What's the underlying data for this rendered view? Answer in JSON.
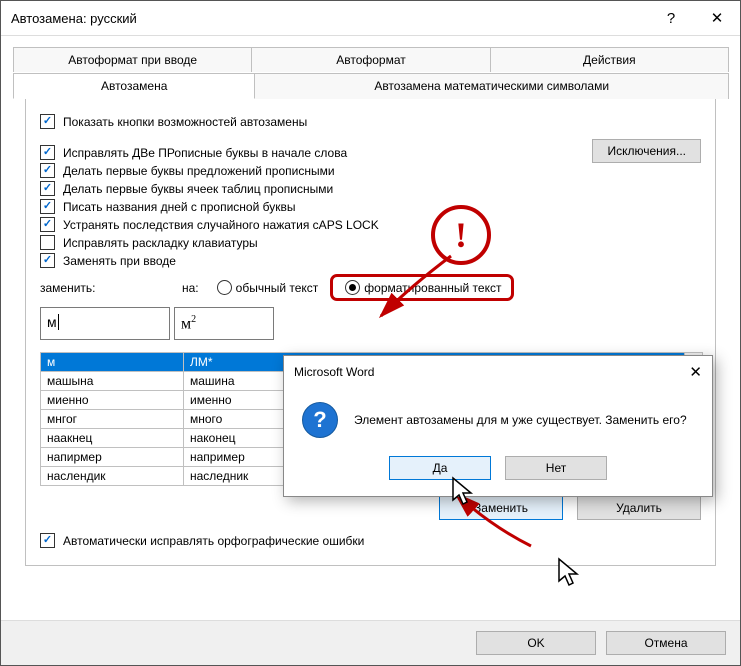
{
  "title": "Автозамена: русский",
  "help_symbol": "?",
  "close_symbol": "✕",
  "tabs_top": [
    "Автоформат при вводе",
    "Автоформат",
    "Действия"
  ],
  "tabs_bottom": [
    "Автозамена",
    "Автозамена математическими символами"
  ],
  "active_tab": "Автозамена",
  "chk_show_buttons": "Показать кнопки возможностей автозамены",
  "chk_two_caps": "Исправлять ДВе ПРописные буквы в начале слова",
  "chk_first_sentence": "Делать первые буквы предложений прописными",
  "chk_first_cells": "Делать первые буквы ячеек таблиц прописными",
  "chk_days": "Писать названия дней с прописной буквы",
  "chk_capslock": "Устранять последствия случайного нажатия cAPS LOCK",
  "chk_keyboard": "Исправлять раскладку клавиатуры",
  "chk_replace_typing": "Заменять при вводе",
  "exceptions_btn": "Исключения...",
  "label_replace": "заменить:",
  "label_with": "на:",
  "radio_plain": "обычный текст",
  "radio_formatted": "форматированный текст",
  "input_left_value": "м",
  "input_right_value": "м",
  "input_right_sup": "2",
  "table": {
    "header": [
      "м",
      "ЛМ*"
    ],
    "rows": [
      [
        "машына",
        "машина"
      ],
      [
        "миенно",
        "именно"
      ],
      [
        "мнгог",
        "много"
      ],
      [
        "наакнец",
        "наконец"
      ],
      [
        "напирмер",
        "например"
      ],
      [
        "наслендик",
        "наследник"
      ]
    ]
  },
  "btn_replace": "Заменить",
  "btn_delete": "Удалить",
  "chk_auto_spell": "Автоматически исправлять орфографические ошибки",
  "footer_ok": "OK",
  "footer_cancel": "Отмена",
  "msgbox": {
    "title": "Microsoft Word",
    "text": "Элемент автозамены для м уже существует. Заменить его?",
    "yes": "Да",
    "no": "Нет"
  },
  "annot_exclaim": "!"
}
